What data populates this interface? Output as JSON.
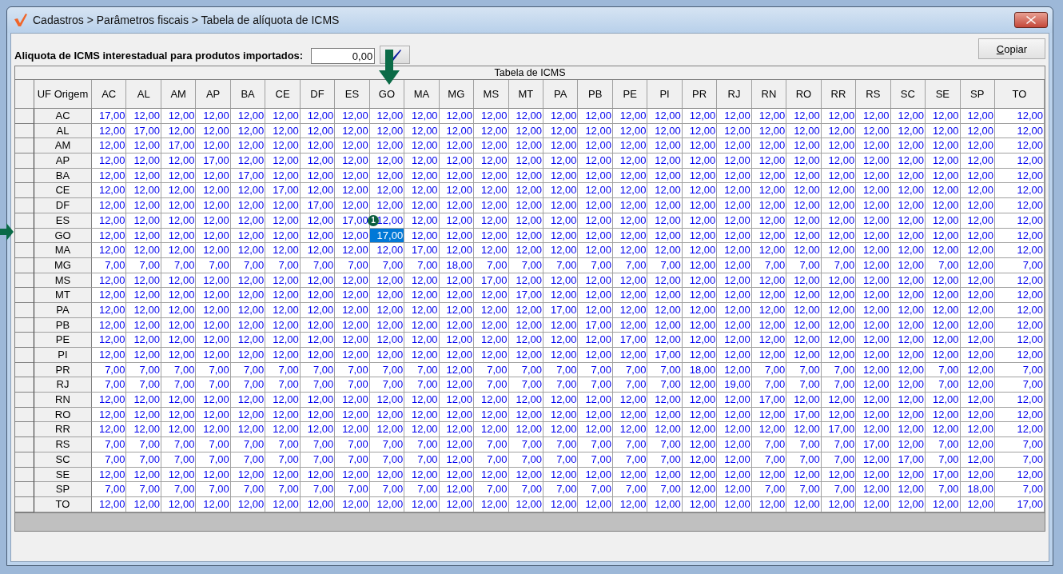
{
  "window": {
    "title": "Cadastros > Parâmetros fiscais > Tabela de alíquota de ICMS"
  },
  "import_rate": {
    "label": "Aliquota de ICMS interestadual para produtos importados:",
    "value": "0,00"
  },
  "copy_button": {
    "label": "Copiar"
  },
  "table": {
    "title": "Tabela de ICMS",
    "row_header_title": "UF Origem",
    "columns": [
      {
        "label": "AC"
      },
      {
        "label": "AL"
      },
      {
        "label": "AM"
      },
      {
        "label": "AP"
      },
      {
        "label": "BA"
      },
      {
        "label": "CE"
      },
      {
        "label": "DF"
      },
      {
        "label": "ES"
      },
      {
        "label": "GO"
      },
      {
        "label": "MA"
      },
      {
        "label": "MG"
      },
      {
        "label": "MS"
      },
      {
        "label": "MT"
      },
      {
        "label": "PA"
      },
      {
        "label": "PB"
      },
      {
        "label": "PE"
      },
      {
        "label": "PI"
      },
      {
        "label": "PR"
      },
      {
        "label": "RJ"
      },
      {
        "label": "RN"
      },
      {
        "label": "RO"
      },
      {
        "label": "RR"
      },
      {
        "label": "RS"
      },
      {
        "label": "SC"
      },
      {
        "label": "SE"
      },
      {
        "label": "SP"
      },
      {
        "label": "TO"
      }
    ],
    "rows": [
      {
        "uf": "AC",
        "selected": [
          false,
          false,
          false,
          false,
          false,
          false,
          false,
          false,
          false,
          false,
          false,
          false,
          false,
          false,
          false,
          false,
          false,
          false,
          false,
          false,
          false,
          false,
          false,
          false,
          false,
          false,
          false
        ],
        "values": [
          "17,00",
          "12,00",
          "12,00",
          "12,00",
          "12,00",
          "12,00",
          "12,00",
          "12,00",
          "12,00",
          "12,00",
          "12,00",
          "12,00",
          "12,00",
          "12,00",
          "12,00",
          "12,00",
          "12,00",
          "12,00",
          "12,00",
          "12,00",
          "12,00",
          "12,00",
          "12,00",
          "12,00",
          "12,00",
          "12,00",
          "12,00"
        ]
      },
      {
        "uf": "AL",
        "selected": [
          false,
          false,
          false,
          false,
          false,
          false,
          false,
          false,
          false,
          false,
          false,
          false,
          false,
          false,
          false,
          false,
          false,
          false,
          false,
          false,
          false,
          false,
          false,
          false,
          false,
          false,
          false
        ],
        "values": [
          "12,00",
          "17,00",
          "12,00",
          "12,00",
          "12,00",
          "12,00",
          "12,00",
          "12,00",
          "12,00",
          "12,00",
          "12,00",
          "12,00",
          "12,00",
          "12,00",
          "12,00",
          "12,00",
          "12,00",
          "12,00",
          "12,00",
          "12,00",
          "12,00",
          "12,00",
          "12,00",
          "12,00",
          "12,00",
          "12,00",
          "12,00"
        ]
      },
      {
        "uf": "AM",
        "selected": [
          false,
          false,
          false,
          false,
          false,
          false,
          false,
          false,
          false,
          false,
          false,
          false,
          false,
          false,
          false,
          false,
          false,
          false,
          false,
          false,
          false,
          false,
          false,
          false,
          false,
          false,
          false
        ],
        "values": [
          "12,00",
          "12,00",
          "17,00",
          "12,00",
          "12,00",
          "12,00",
          "12,00",
          "12,00",
          "12,00",
          "12,00",
          "12,00",
          "12,00",
          "12,00",
          "12,00",
          "12,00",
          "12,00",
          "12,00",
          "12,00",
          "12,00",
          "12,00",
          "12,00",
          "12,00",
          "12,00",
          "12,00",
          "12,00",
          "12,00",
          "12,00"
        ]
      },
      {
        "uf": "AP",
        "selected": [
          false,
          false,
          false,
          false,
          false,
          false,
          false,
          false,
          false,
          false,
          false,
          false,
          false,
          false,
          false,
          false,
          false,
          false,
          false,
          false,
          false,
          false,
          false,
          false,
          false,
          false,
          false
        ],
        "values": [
          "12,00",
          "12,00",
          "12,00",
          "17,00",
          "12,00",
          "12,00",
          "12,00",
          "12,00",
          "12,00",
          "12,00",
          "12,00",
          "12,00",
          "12,00",
          "12,00",
          "12,00",
          "12,00",
          "12,00",
          "12,00",
          "12,00",
          "12,00",
          "12,00",
          "12,00",
          "12,00",
          "12,00",
          "12,00",
          "12,00",
          "12,00"
        ]
      },
      {
        "uf": "BA",
        "selected": [
          false,
          false,
          false,
          false,
          false,
          false,
          false,
          false,
          false,
          false,
          false,
          false,
          false,
          false,
          false,
          false,
          false,
          false,
          false,
          false,
          false,
          false,
          false,
          false,
          false,
          false,
          false
        ],
        "values": [
          "12,00",
          "12,00",
          "12,00",
          "12,00",
          "17,00",
          "12,00",
          "12,00",
          "12,00",
          "12,00",
          "12,00",
          "12,00",
          "12,00",
          "12,00",
          "12,00",
          "12,00",
          "12,00",
          "12,00",
          "12,00",
          "12,00",
          "12,00",
          "12,00",
          "12,00",
          "12,00",
          "12,00",
          "12,00",
          "12,00",
          "12,00"
        ]
      },
      {
        "uf": "CE",
        "selected": [
          false,
          false,
          false,
          false,
          false,
          false,
          false,
          false,
          false,
          false,
          false,
          false,
          false,
          false,
          false,
          false,
          false,
          false,
          false,
          false,
          false,
          false,
          false,
          false,
          false,
          false,
          false
        ],
        "values": [
          "12,00",
          "12,00",
          "12,00",
          "12,00",
          "12,00",
          "17,00",
          "12,00",
          "12,00",
          "12,00",
          "12,00",
          "12,00",
          "12,00",
          "12,00",
          "12,00",
          "12,00",
          "12,00",
          "12,00",
          "12,00",
          "12,00",
          "12,00",
          "12,00",
          "12,00",
          "12,00",
          "12,00",
          "12,00",
          "12,00",
          "12,00"
        ]
      },
      {
        "uf": "DF",
        "selected": [
          false,
          false,
          false,
          false,
          false,
          false,
          false,
          false,
          false,
          false,
          false,
          false,
          false,
          false,
          false,
          false,
          false,
          false,
          false,
          false,
          false,
          false,
          false,
          false,
          false,
          false,
          false
        ],
        "values": [
          "12,00",
          "12,00",
          "12,00",
          "12,00",
          "12,00",
          "12,00",
          "17,00",
          "12,00",
          "12,00",
          "12,00",
          "12,00",
          "12,00",
          "12,00",
          "12,00",
          "12,00",
          "12,00",
          "12,00",
          "12,00",
          "12,00",
          "12,00",
          "12,00",
          "12,00",
          "12,00",
          "12,00",
          "12,00",
          "12,00",
          "12,00"
        ]
      },
      {
        "uf": "ES",
        "selected": [
          false,
          false,
          false,
          false,
          false,
          false,
          false,
          false,
          false,
          false,
          false,
          false,
          false,
          false,
          false,
          false,
          false,
          false,
          false,
          false,
          false,
          false,
          false,
          false,
          false,
          false,
          false
        ],
        "values": [
          "12,00",
          "12,00",
          "12,00",
          "12,00",
          "12,00",
          "12,00",
          "12,00",
          "17,00",
          "12,00",
          "12,00",
          "12,00",
          "12,00",
          "12,00",
          "12,00",
          "12,00",
          "12,00",
          "12,00",
          "12,00",
          "12,00",
          "12,00",
          "12,00",
          "12,00",
          "12,00",
          "12,00",
          "12,00",
          "12,00",
          "12,00"
        ]
      },
      {
        "uf": "GO",
        "selected": [
          false,
          false,
          false,
          false,
          false,
          false,
          false,
          false,
          true,
          false,
          false,
          false,
          false,
          false,
          false,
          false,
          false,
          false,
          false,
          false,
          false,
          false,
          false,
          false,
          false,
          false,
          false
        ],
        "values": [
          "12,00",
          "12,00",
          "12,00",
          "12,00",
          "12,00",
          "12,00",
          "12,00",
          "12,00",
          "17,00",
          "12,00",
          "12,00",
          "12,00",
          "12,00",
          "12,00",
          "12,00",
          "12,00",
          "12,00",
          "12,00",
          "12,00",
          "12,00",
          "12,00",
          "12,00",
          "12,00",
          "12,00",
          "12,00",
          "12,00",
          "12,00"
        ]
      },
      {
        "uf": "MA",
        "selected": [
          false,
          false,
          false,
          false,
          false,
          false,
          false,
          false,
          false,
          false,
          false,
          false,
          false,
          false,
          false,
          false,
          false,
          false,
          false,
          false,
          false,
          false,
          false,
          false,
          false,
          false,
          false
        ],
        "values": [
          "12,00",
          "12,00",
          "12,00",
          "12,00",
          "12,00",
          "12,00",
          "12,00",
          "12,00",
          "12,00",
          "17,00",
          "12,00",
          "12,00",
          "12,00",
          "12,00",
          "12,00",
          "12,00",
          "12,00",
          "12,00",
          "12,00",
          "12,00",
          "12,00",
          "12,00",
          "12,00",
          "12,00",
          "12,00",
          "12,00",
          "12,00"
        ]
      },
      {
        "uf": "MG",
        "selected": [
          false,
          false,
          false,
          false,
          false,
          false,
          false,
          false,
          false,
          false,
          false,
          false,
          false,
          false,
          false,
          false,
          false,
          false,
          false,
          false,
          false,
          false,
          false,
          false,
          false,
          false,
          false
        ],
        "values": [
          "7,00",
          "7,00",
          "7,00",
          "7,00",
          "7,00",
          "7,00",
          "7,00",
          "7,00",
          "7,00",
          "7,00",
          "18,00",
          "7,00",
          "7,00",
          "7,00",
          "7,00",
          "7,00",
          "7,00",
          "12,00",
          "12,00",
          "7,00",
          "7,00",
          "7,00",
          "12,00",
          "12,00",
          "7,00",
          "12,00",
          "7,00"
        ]
      },
      {
        "uf": "MS",
        "selected": [
          false,
          false,
          false,
          false,
          false,
          false,
          false,
          false,
          false,
          false,
          false,
          false,
          false,
          false,
          false,
          false,
          false,
          false,
          false,
          false,
          false,
          false,
          false,
          false,
          false,
          false,
          false
        ],
        "values": [
          "12,00",
          "12,00",
          "12,00",
          "12,00",
          "12,00",
          "12,00",
          "12,00",
          "12,00",
          "12,00",
          "12,00",
          "12,00",
          "17,00",
          "12,00",
          "12,00",
          "12,00",
          "12,00",
          "12,00",
          "12,00",
          "12,00",
          "12,00",
          "12,00",
          "12,00",
          "12,00",
          "12,00",
          "12,00",
          "12,00",
          "12,00"
        ]
      },
      {
        "uf": "MT",
        "selected": [
          false,
          false,
          false,
          false,
          false,
          false,
          false,
          false,
          false,
          false,
          false,
          false,
          false,
          false,
          false,
          false,
          false,
          false,
          false,
          false,
          false,
          false,
          false,
          false,
          false,
          false,
          false
        ],
        "values": [
          "12,00",
          "12,00",
          "12,00",
          "12,00",
          "12,00",
          "12,00",
          "12,00",
          "12,00",
          "12,00",
          "12,00",
          "12,00",
          "12,00",
          "17,00",
          "12,00",
          "12,00",
          "12,00",
          "12,00",
          "12,00",
          "12,00",
          "12,00",
          "12,00",
          "12,00",
          "12,00",
          "12,00",
          "12,00",
          "12,00",
          "12,00"
        ]
      },
      {
        "uf": "PA",
        "selected": [
          false,
          false,
          false,
          false,
          false,
          false,
          false,
          false,
          false,
          false,
          false,
          false,
          false,
          false,
          false,
          false,
          false,
          false,
          false,
          false,
          false,
          false,
          false,
          false,
          false,
          false,
          false
        ],
        "values": [
          "12,00",
          "12,00",
          "12,00",
          "12,00",
          "12,00",
          "12,00",
          "12,00",
          "12,00",
          "12,00",
          "12,00",
          "12,00",
          "12,00",
          "12,00",
          "17,00",
          "12,00",
          "12,00",
          "12,00",
          "12,00",
          "12,00",
          "12,00",
          "12,00",
          "12,00",
          "12,00",
          "12,00",
          "12,00",
          "12,00",
          "12,00"
        ]
      },
      {
        "uf": "PB",
        "selected": [
          false,
          false,
          false,
          false,
          false,
          false,
          false,
          false,
          false,
          false,
          false,
          false,
          false,
          false,
          false,
          false,
          false,
          false,
          false,
          false,
          false,
          false,
          false,
          false,
          false,
          false,
          false
        ],
        "values": [
          "12,00",
          "12,00",
          "12,00",
          "12,00",
          "12,00",
          "12,00",
          "12,00",
          "12,00",
          "12,00",
          "12,00",
          "12,00",
          "12,00",
          "12,00",
          "12,00",
          "17,00",
          "12,00",
          "12,00",
          "12,00",
          "12,00",
          "12,00",
          "12,00",
          "12,00",
          "12,00",
          "12,00",
          "12,00",
          "12,00",
          "12,00"
        ]
      },
      {
        "uf": "PE",
        "selected": [
          false,
          false,
          false,
          false,
          false,
          false,
          false,
          false,
          false,
          false,
          false,
          false,
          false,
          false,
          false,
          false,
          false,
          false,
          false,
          false,
          false,
          false,
          false,
          false,
          false,
          false,
          false
        ],
        "values": [
          "12,00",
          "12,00",
          "12,00",
          "12,00",
          "12,00",
          "12,00",
          "12,00",
          "12,00",
          "12,00",
          "12,00",
          "12,00",
          "12,00",
          "12,00",
          "12,00",
          "12,00",
          "17,00",
          "12,00",
          "12,00",
          "12,00",
          "12,00",
          "12,00",
          "12,00",
          "12,00",
          "12,00",
          "12,00",
          "12,00",
          "12,00"
        ]
      },
      {
        "uf": "PI",
        "selected": [
          false,
          false,
          false,
          false,
          false,
          false,
          false,
          false,
          false,
          false,
          false,
          false,
          false,
          false,
          false,
          false,
          false,
          false,
          false,
          false,
          false,
          false,
          false,
          false,
          false,
          false,
          false
        ],
        "values": [
          "12,00",
          "12,00",
          "12,00",
          "12,00",
          "12,00",
          "12,00",
          "12,00",
          "12,00",
          "12,00",
          "12,00",
          "12,00",
          "12,00",
          "12,00",
          "12,00",
          "12,00",
          "12,00",
          "17,00",
          "12,00",
          "12,00",
          "12,00",
          "12,00",
          "12,00",
          "12,00",
          "12,00",
          "12,00",
          "12,00",
          "12,00"
        ]
      },
      {
        "uf": "PR",
        "selected": [
          false,
          false,
          false,
          false,
          false,
          false,
          false,
          false,
          false,
          false,
          false,
          false,
          false,
          false,
          false,
          false,
          false,
          false,
          false,
          false,
          false,
          false,
          false,
          false,
          false,
          false,
          false
        ],
        "values": [
          "7,00",
          "7,00",
          "7,00",
          "7,00",
          "7,00",
          "7,00",
          "7,00",
          "7,00",
          "7,00",
          "7,00",
          "12,00",
          "7,00",
          "7,00",
          "7,00",
          "7,00",
          "7,00",
          "7,00",
          "18,00",
          "12,00",
          "7,00",
          "7,00",
          "7,00",
          "12,00",
          "12,00",
          "7,00",
          "12,00",
          "7,00"
        ]
      },
      {
        "uf": "RJ",
        "selected": [
          false,
          false,
          false,
          false,
          false,
          false,
          false,
          false,
          false,
          false,
          false,
          false,
          false,
          false,
          false,
          false,
          false,
          false,
          false,
          false,
          false,
          false,
          false,
          false,
          false,
          false,
          false
        ],
        "values": [
          "7,00",
          "7,00",
          "7,00",
          "7,00",
          "7,00",
          "7,00",
          "7,00",
          "7,00",
          "7,00",
          "7,00",
          "12,00",
          "7,00",
          "7,00",
          "7,00",
          "7,00",
          "7,00",
          "7,00",
          "12,00",
          "19,00",
          "7,00",
          "7,00",
          "7,00",
          "12,00",
          "12,00",
          "7,00",
          "12,00",
          "7,00"
        ]
      },
      {
        "uf": "RN",
        "selected": [
          false,
          false,
          false,
          false,
          false,
          false,
          false,
          false,
          false,
          false,
          false,
          false,
          false,
          false,
          false,
          false,
          false,
          false,
          false,
          false,
          false,
          false,
          false,
          false,
          false,
          false,
          false
        ],
        "values": [
          "12,00",
          "12,00",
          "12,00",
          "12,00",
          "12,00",
          "12,00",
          "12,00",
          "12,00",
          "12,00",
          "12,00",
          "12,00",
          "12,00",
          "12,00",
          "12,00",
          "12,00",
          "12,00",
          "12,00",
          "12,00",
          "12,00",
          "17,00",
          "12,00",
          "12,00",
          "12,00",
          "12,00",
          "12,00",
          "12,00",
          "12,00"
        ]
      },
      {
        "uf": "RO",
        "selected": [
          false,
          false,
          false,
          false,
          false,
          false,
          false,
          false,
          false,
          false,
          false,
          false,
          false,
          false,
          false,
          false,
          false,
          false,
          false,
          false,
          false,
          false,
          false,
          false,
          false,
          false,
          false
        ],
        "values": [
          "12,00",
          "12,00",
          "12,00",
          "12,00",
          "12,00",
          "12,00",
          "12,00",
          "12,00",
          "12,00",
          "12,00",
          "12,00",
          "12,00",
          "12,00",
          "12,00",
          "12,00",
          "12,00",
          "12,00",
          "12,00",
          "12,00",
          "12,00",
          "17,00",
          "12,00",
          "12,00",
          "12,00",
          "12,00",
          "12,00",
          "12,00"
        ]
      },
      {
        "uf": "RR",
        "selected": [
          false,
          false,
          false,
          false,
          false,
          false,
          false,
          false,
          false,
          false,
          false,
          false,
          false,
          false,
          false,
          false,
          false,
          false,
          false,
          false,
          false,
          false,
          false,
          false,
          false,
          false,
          false
        ],
        "values": [
          "12,00",
          "12,00",
          "12,00",
          "12,00",
          "12,00",
          "12,00",
          "12,00",
          "12,00",
          "12,00",
          "12,00",
          "12,00",
          "12,00",
          "12,00",
          "12,00",
          "12,00",
          "12,00",
          "12,00",
          "12,00",
          "12,00",
          "12,00",
          "12,00",
          "17,00",
          "12,00",
          "12,00",
          "12,00",
          "12,00",
          "12,00"
        ]
      },
      {
        "uf": "RS",
        "selected": [
          false,
          false,
          false,
          false,
          false,
          false,
          false,
          false,
          false,
          false,
          false,
          false,
          false,
          false,
          false,
          false,
          false,
          false,
          false,
          false,
          false,
          false,
          false,
          false,
          false,
          false,
          false
        ],
        "values": [
          "7,00",
          "7,00",
          "7,00",
          "7,00",
          "7,00",
          "7,00",
          "7,00",
          "7,00",
          "7,00",
          "7,00",
          "12,00",
          "7,00",
          "7,00",
          "7,00",
          "7,00",
          "7,00",
          "7,00",
          "12,00",
          "12,00",
          "7,00",
          "7,00",
          "7,00",
          "17,00",
          "12,00",
          "7,00",
          "12,00",
          "7,00"
        ]
      },
      {
        "uf": "SC",
        "selected": [
          false,
          false,
          false,
          false,
          false,
          false,
          false,
          false,
          false,
          false,
          false,
          false,
          false,
          false,
          false,
          false,
          false,
          false,
          false,
          false,
          false,
          false,
          false,
          false,
          false,
          false,
          false
        ],
        "values": [
          "7,00",
          "7,00",
          "7,00",
          "7,00",
          "7,00",
          "7,00",
          "7,00",
          "7,00",
          "7,00",
          "7,00",
          "12,00",
          "7,00",
          "7,00",
          "7,00",
          "7,00",
          "7,00",
          "7,00",
          "12,00",
          "12,00",
          "7,00",
          "7,00",
          "7,00",
          "12,00",
          "17,00",
          "7,00",
          "12,00",
          "7,00"
        ]
      },
      {
        "uf": "SE",
        "selected": [
          false,
          false,
          false,
          false,
          false,
          false,
          false,
          false,
          false,
          false,
          false,
          false,
          false,
          false,
          false,
          false,
          false,
          false,
          false,
          false,
          false,
          false,
          false,
          false,
          false,
          false,
          false
        ],
        "values": [
          "12,00",
          "12,00",
          "12,00",
          "12,00",
          "12,00",
          "12,00",
          "12,00",
          "12,00",
          "12,00",
          "12,00",
          "12,00",
          "12,00",
          "12,00",
          "12,00",
          "12,00",
          "12,00",
          "12,00",
          "12,00",
          "12,00",
          "12,00",
          "12,00",
          "12,00",
          "12,00",
          "12,00",
          "17,00",
          "12,00",
          "12,00"
        ]
      },
      {
        "uf": "SP",
        "selected": [
          false,
          false,
          false,
          false,
          false,
          false,
          false,
          false,
          false,
          false,
          false,
          false,
          false,
          false,
          false,
          false,
          false,
          false,
          false,
          false,
          false,
          false,
          false,
          false,
          false,
          false,
          false
        ],
        "values": [
          "7,00",
          "7,00",
          "7,00",
          "7,00",
          "7,00",
          "7,00",
          "7,00",
          "7,00",
          "7,00",
          "7,00",
          "12,00",
          "7,00",
          "7,00",
          "7,00",
          "7,00",
          "7,00",
          "7,00",
          "12,00",
          "12,00",
          "7,00",
          "7,00",
          "7,00",
          "12,00",
          "12,00",
          "7,00",
          "18,00",
          "7,00"
        ]
      },
      {
        "uf": "TO",
        "selected": [
          false,
          false,
          false,
          false,
          false,
          false,
          false,
          false,
          false,
          false,
          false,
          false,
          false,
          false,
          false,
          false,
          false,
          false,
          false,
          false,
          false,
          false,
          false,
          false,
          false,
          false,
          false
        ],
        "values": [
          "12,00",
          "12,00",
          "12,00",
          "12,00",
          "12,00",
          "12,00",
          "12,00",
          "12,00",
          "12,00",
          "12,00",
          "12,00",
          "12,00",
          "12,00",
          "12,00",
          "12,00",
          "12,00",
          "12,00",
          "12,00",
          "12,00",
          "12,00",
          "12,00",
          "12,00",
          "12,00",
          "12,00",
          "12,00",
          "12,00",
          "17,00"
        ]
      }
    ]
  },
  "annotations": [
    {
      "kind": "down-arrow"
    },
    {
      "kind": "right-arrow"
    },
    {
      "kind": "badge",
      "text": "1"
    }
  ]
}
